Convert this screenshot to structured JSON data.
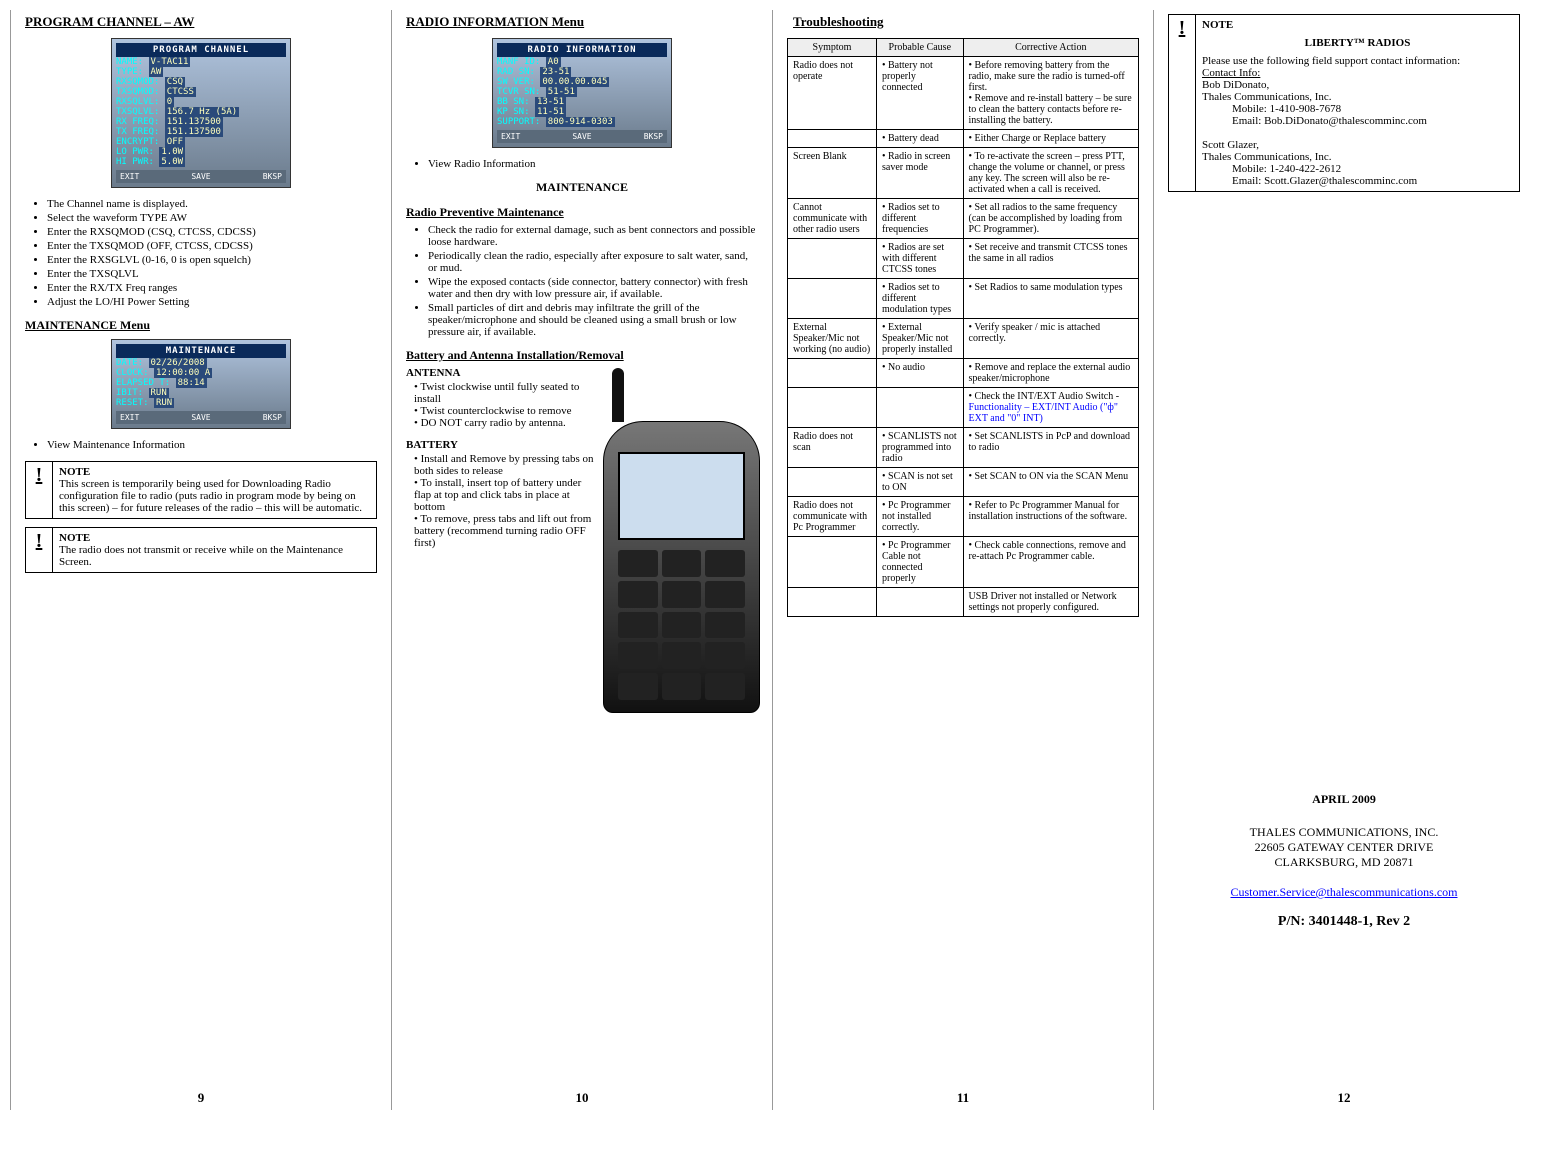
{
  "page9": {
    "title": "PROGRAM CHANNEL – AW",
    "radio": {
      "bar": "PROGRAM CHANNEL",
      "rows": [
        [
          "NAME:",
          "V-TAC11"
        ],
        [
          "TYPE:",
          "AW"
        ],
        [
          "RXSQMOD:",
          "CSQ"
        ],
        [
          "TXSQMOD:",
          "CTCSS"
        ],
        [
          "RXSQLVL:",
          "0"
        ],
        [
          "TXSQLVL:",
          "156.7 Hz (5A)"
        ],
        [
          "RX FREQ:",
          "151.137500"
        ],
        [
          "TX FREQ:",
          "151.137500"
        ],
        [
          "ENCRYPT:",
          "OFF"
        ],
        [
          "LO PWR:",
          "1.0W"
        ],
        [
          "HI PWR:",
          "5.0W"
        ]
      ],
      "footer": [
        "EXIT",
        "SAVE",
        "BKSP"
      ]
    },
    "bullets": [
      "The Channel name is displayed.",
      "Select the waveform TYPE AW",
      "Enter the RXSQMOD (CSQ, CTCSS, CDCSS)",
      "Enter the TXSQMOD (OFF, CTCSS, CDCSS)",
      "Enter the RXSGLVL (0-16, 0 is open squelch)",
      "Enter the TXSQLVL",
      "Enter the RX/TX Freq ranges",
      "Adjust the LO/HI Power Setting"
    ],
    "maintTitle": "MAINTENANCE Menu",
    "radio2": {
      "bar": "MAINTENANCE",
      "rows": [
        [
          "DATE:",
          "02/26/2008"
        ],
        [
          "CLOCK:",
          "12:00:00 A"
        ],
        [
          "ELAPSED T:",
          "88:14"
        ],
        [
          "IBIT:",
          "RUN"
        ],
        [
          "RESET:",
          "RUN"
        ]
      ],
      "footer": [
        "EXIT",
        "SAVE",
        "BKSP"
      ]
    },
    "maintBullet": "View Maintenance Information",
    "note1": {
      "title": "NOTE",
      "body": "This screen is temporarily being used for Downloading Radio configuration file to radio (puts radio in program mode by being on this screen) – for future releases of the radio – this will be automatic."
    },
    "note2": {
      "title": "NOTE",
      "body": "The radio does not transmit or receive while on the Maintenance Screen."
    },
    "num": "9"
  },
  "page10": {
    "title": "RADIO INFORMATION Menu",
    "radio": {
      "bar": "RADIO INFORMATION",
      "rows": [
        [
          "MANF ID:",
          "A0"
        ],
        [
          "RAD SN:",
          "23-51"
        ],
        [
          "SW VER:",
          "00.00.00.045"
        ],
        [
          "TCVR SN:",
          "51-51"
        ],
        [
          "BB SN:",
          "13-51"
        ],
        [
          "KP SN:",
          "11-51"
        ],
        [
          "SUPPORT:",
          "800-914-0303"
        ]
      ],
      "footer": [
        "EXIT",
        "SAVE",
        "BKSP"
      ]
    },
    "b1": "View Radio Information",
    "mTitle": "MAINTENANCE",
    "prevTitle": "Radio Preventive Maintenance",
    "prevList": [
      "Check the radio for external damage, such as bent connectors and possible loose hardware.",
      "Periodically clean the radio, especially after exposure to salt water, sand, or mud.",
      "Wipe the exposed contacts (side connector, battery connector) with fresh water and then dry with low pressure air, if available.",
      "Small particles of dirt and debris may infiltrate the grill of the speaker/microphone and should be cleaned using a small brush or low pressure air, if available."
    ],
    "batAntTitle": "Battery and Antenna Installation/Removal",
    "antTitle": "ANTENNA",
    "antList": [
      "Twist clockwise until fully seated to install",
      "Twist counterclockwise to remove",
      "DO NOT carry radio by antenna."
    ],
    "batTitle": "BATTERY",
    "batList": [
      "Install and Remove by pressing tabs on both sides to release",
      "To install, insert top of battery under flap at top and click tabs in place at bottom",
      "To remove, press tabs and lift out from battery (recommend turning radio OFF first)"
    ],
    "num": "10"
  },
  "page11": {
    "title": "Troubleshooting",
    "headers": [
      "Symptom",
      "Probable Cause",
      "Corrective Action"
    ],
    "rows": [
      {
        "s": "Radio does not operate",
        "c": "• Battery not properly connected",
        "a": "•   Before removing battery from the radio, make sure the radio is turned-off first.\n•   Remove and re-install battery – be sure to clean the battery contacts before re-installing the battery."
      },
      {
        "s": "",
        "c": "• Battery dead",
        "a": "•   Either Charge or Replace battery"
      },
      {
        "s": "Screen Blank",
        "c": "• Radio in screen saver mode",
        "a": "•   To re-activate the screen – press PTT, change the volume or channel, or press any key.  The screen will also be re-activated when a call is received."
      },
      {
        "s": "Cannot communicate with other radio users",
        "c": "• Radios set to different frequencies",
        "a": "• Set all radios to the same frequency (can be accomplished by loading from PC Programmer)."
      },
      {
        "s": "",
        "c": "• Radios are set with different CTCSS tones",
        "a": "• Set receive and transmit CTCSS tones the same in all radios"
      },
      {
        "s": "",
        "c": "• Radios set to different modulation types",
        "a": "• Set Radios to same modulation types"
      },
      {
        "s": "External Speaker/Mic not working (no audio)",
        "c": "• External Speaker/Mic not properly installed",
        "a": "• Verify speaker / mic is attached correctly."
      },
      {
        "s": "",
        "c": "• No audio",
        "a": "• Remove and replace the external audio speaker/microphone"
      },
      {
        "s": "",
        "c": "",
        "a": "• Check the INT/EXT Audio Switch  - ",
        "af": "Functionality – EXT/INT Audio (\"ф\" EXT and \"0\" INT)"
      },
      {
        "s": "Radio does not scan",
        "c": "• SCANLISTS not programmed into radio",
        "a": "• Set SCANLISTS in PcP and download to radio"
      },
      {
        "s": "",
        "c": "• SCAN is not set to ON",
        "a": "• Set SCAN to ON via the SCAN Menu"
      },
      {
        "s": "Radio does not communicate with Pc Programmer",
        "c": "• Pc Programmer not installed correctly.",
        "a": "• Refer to Pc Programmer  Manual for installation instructions of the software."
      },
      {
        "s": "",
        "c": "• Pc Programmer Cable not connected properly",
        "a": "• Check cable connections, remove and re-attach Pc Programmer cable."
      },
      {
        "s": "",
        "c": "",
        "a": "USB Driver not installed or Network settings not properly configured."
      }
    ],
    "num": "11"
  },
  "page12": {
    "note": {
      "title": "NOTE",
      "heading": "LIBERTY™ RADIOS",
      "intro": "Please use the following field support contact information:",
      "ci": "Contact Info:",
      "c1name": "Bob DiDonato,",
      "c1org": "Thales Communications, Inc.",
      "c1mob": "Mobile: 1-410-908-7678",
      "c1em": "Email: Bob.DiDonato@thalescomminc.com",
      "c2name": "Scott Glazer,",
      "c2org": "Thales Communications, Inc.",
      "c2mob": "Mobile: 1-240-422-2612",
      "c2em": "Email: Scott.Glazer@thalescomminc.com"
    },
    "date": "APRIL 2009",
    "co1": "THALES COMMUNICATIONS, INC.",
    "co2": "22605 GATEWAY CENTER DRIVE",
    "co3": "CLARKSBURG, MD 20871",
    "email": "Customer.Service@thalescommunications.com",
    "pn": "P/N: 3401448-1, Rev 2",
    "num": "12"
  }
}
